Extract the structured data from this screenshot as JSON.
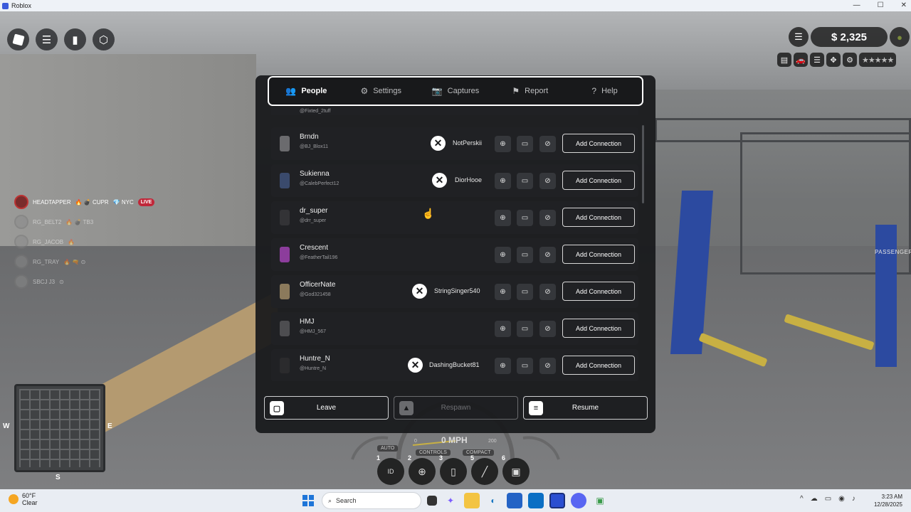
{
  "window": {
    "title": "Roblox",
    "controls": [
      "—",
      "☐",
      "✕"
    ]
  },
  "topleft": [
    {
      "name": "roblox-logo-button",
      "glyph": ""
    },
    {
      "name": "menu-icon",
      "glyph": "☰"
    },
    {
      "name": "chat-icon",
      "glyph": "▮"
    },
    {
      "name": "backpack-icon",
      "glyph": "⬡"
    }
  ],
  "hud": {
    "money": "$ 2,325",
    "list_icon": "☰",
    "bag_icon": "●",
    "row_icons": [
      "▤",
      "🚗",
      "☰",
      "✥",
      "⚙"
    ],
    "stars": "★★★★★",
    "passengers": "PASSENGERS"
  },
  "playerlist": [
    {
      "name": "HEADTAPPER",
      "tags": "🔥 💣 CUPR",
      "nyc": "💎 NYC",
      "live": "LIVE"
    },
    {
      "name": "RG_BELT2",
      "tags": "🔥 💣 TB3"
    },
    {
      "name": "RG_JACOB",
      "tags": "🔥"
    },
    {
      "name": "RG_TRAY",
      "tags": "🔥 🔫 ⊙"
    },
    {
      "name": "SBCJ J3",
      "tags": "⊙"
    }
  ],
  "map": {
    "n": "",
    "w": "W",
    "e": "E",
    "s": "S"
  },
  "speedometer": {
    "mph": "0 MPH",
    "auto": "AUTO",
    "controls": "CONTROLS",
    "compact": "COMPACT",
    "zero": "0",
    "two_hundred": "200"
  },
  "hotbar": [
    {
      "num": "1",
      "glyph": "ID"
    },
    {
      "num": "2",
      "glyph": "⊕"
    },
    {
      "num": "3",
      "glyph": "▯"
    },
    {
      "num": "5",
      "glyph": "╱"
    },
    {
      "num": "6",
      "glyph": "▣"
    }
  ],
  "menu": {
    "tabs": [
      {
        "label": "People",
        "icon": "👥"
      },
      {
        "label": "Settings",
        "icon": "⚙"
      },
      {
        "label": "Captures",
        "icon": "📷"
      },
      {
        "label": "Report",
        "icon": "⚑"
      },
      {
        "label": "Help",
        "icon": "?"
      }
    ],
    "partial_user": "@Fixted_2tuff",
    "players": [
      {
        "display": "Brndn",
        "user": "@BJ_Blox11",
        "gamertag": "NotPerskii",
        "av": "#6b6b6e"
      },
      {
        "display": "Sukienna",
        "user": "@CalebPerfect12",
        "gamertag": "DiorHooe",
        "av": "#3a4a6c"
      },
      {
        "display": "dr_super",
        "user": "@drr_super",
        "gamertag": "",
        "av": "#333336"
      },
      {
        "display": "Crescent",
        "user": "@FeatherTail196",
        "gamertag": "",
        "av": "#8c3d9c"
      },
      {
        "display": "OfficerNate",
        "user": "@God321458",
        "gamertag": "StringSinger540",
        "av": "#8b7a5c"
      },
      {
        "display": "HMJ",
        "user": "@HMJ_567",
        "gamertag": "",
        "av": "#4d4d50"
      },
      {
        "display": "Huntre_N",
        "user": "@Huntre_N",
        "gamertag": "DashingBucket81",
        "av": "#2b2b2d"
      }
    ],
    "row_actions": {
      "inspect": "⊕",
      "chat": "▭",
      "block": "⊘",
      "add": "Add Connection"
    },
    "buttons": {
      "leave": "Leave",
      "leave_icon": "▢",
      "respawn": "Respawn",
      "respawn_icon": "▲",
      "resume": "Resume",
      "resume_icon": "≡"
    }
  },
  "taskbar": {
    "weather_temp": "60°F",
    "weather_desc": "Clear",
    "search": "Search",
    "time": "3:23 AM",
    "date": "12/28/2025",
    "tray": [
      "^",
      "☁",
      "▭",
      "◉",
      "♪"
    ]
  }
}
